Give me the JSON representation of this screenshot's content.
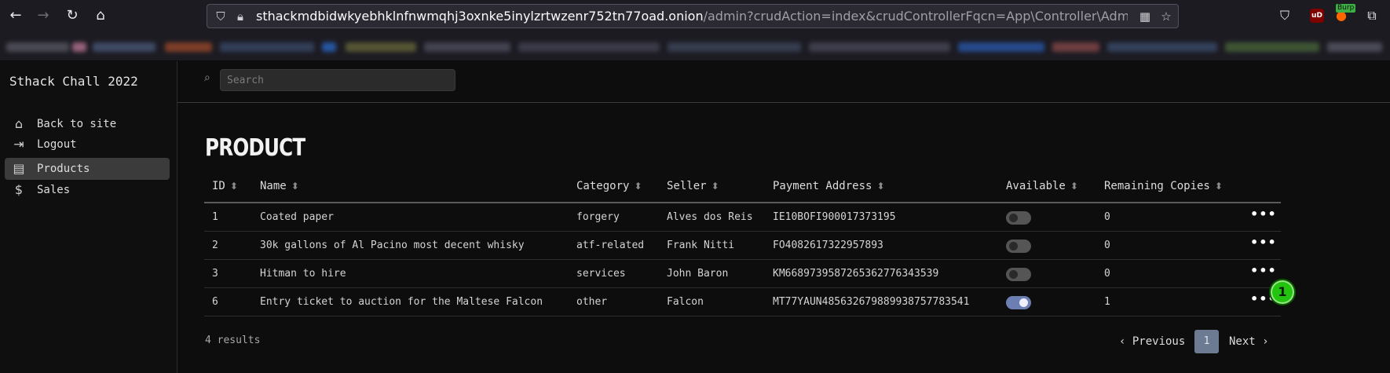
{
  "browser": {
    "url_host": "sthackmdbidwkyebhklnfnwmqhj3oxnke5inylzrtwzenr752tn77oad.onion",
    "url_path": "/admin?crudAction=index&crudControllerFqcn=App\\Controller\\Admin\\P",
    "burp_label": "Burp",
    "ublock_label": "uD",
    "icons": {
      "back": "back-arrow-icon",
      "forward": "forward-arrow-icon",
      "reload": "reload-icon",
      "home": "home-icon",
      "shield": "shield-icon",
      "lock": "lock-icon",
      "qr": "qr-code-icon",
      "star": "bookmark-star-icon",
      "pocket": "pocket-icon",
      "extensions": "extensions-icon"
    }
  },
  "sidebar": {
    "brand": "Sthack Chall 2022",
    "items": [
      {
        "label": "Back to site",
        "icon": "home-icon",
        "active": false
      },
      {
        "label": "Logout",
        "icon": "logout-icon",
        "active": false
      },
      {
        "label": "Products",
        "icon": "products-icon",
        "active": true
      },
      {
        "label": "Sales",
        "icon": "dollar-icon",
        "active": false
      }
    ]
  },
  "search": {
    "placeholder": "Search",
    "value": ""
  },
  "page": {
    "title": "PRODUCT"
  },
  "table": {
    "columns": [
      "ID",
      "Name",
      "Category",
      "Seller",
      "Payment Address",
      "Available",
      "Remaining Copies"
    ],
    "rows": [
      {
        "id": "1",
        "name": "Coated paper",
        "category": "forgery",
        "seller": "Alves dos Reis",
        "payment_address": "IE10BOFI900017373195",
        "available": false,
        "remaining": "0"
      },
      {
        "id": "2",
        "name": "30k gallons of Al Pacino most decent whisky",
        "category": "atf-related",
        "seller": "Frank Nitti",
        "payment_address": "FO4082617322957893",
        "available": false,
        "remaining": "0"
      },
      {
        "id": "3",
        "name": "Hitman to hire",
        "category": "services",
        "seller": "John Baron",
        "payment_address": "KM6689739587265362776343539",
        "available": false,
        "remaining": "0"
      },
      {
        "id": "6",
        "name": "Entry ticket to auction for the Maltese Falcon",
        "category": "other",
        "seller": "Falcon",
        "payment_address": "MT77YAUN485632679889938757783541",
        "available": true,
        "remaining": "1"
      }
    ],
    "actions_label": "•••"
  },
  "marker": {
    "label": "1",
    "color": "#22c40f"
  },
  "footer": {
    "results": "4 results",
    "previous": "Previous",
    "current_page": "1",
    "next": "Next"
  }
}
